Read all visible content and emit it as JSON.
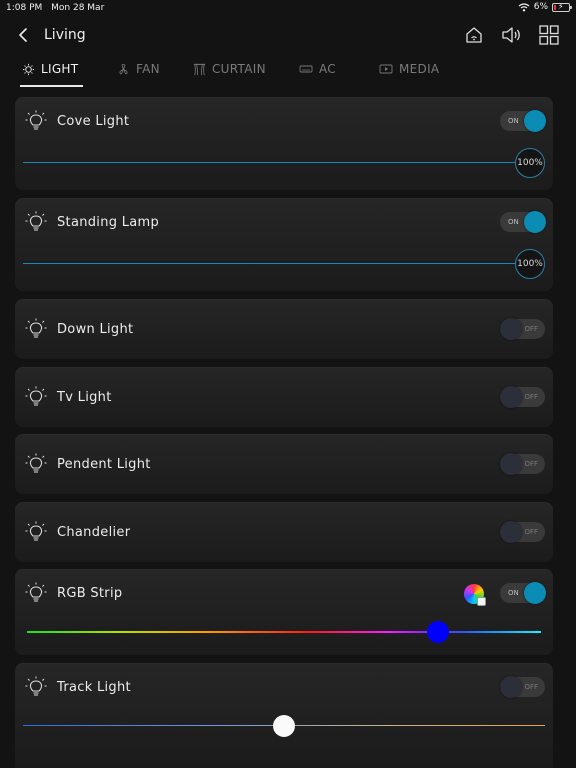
{
  "status_bar": {
    "time": "1:08 PM",
    "date": "Mon 28 Mar",
    "battery": "6%"
  },
  "header": {
    "title": "Living",
    "icons": [
      "back-chevron-icon",
      "home-icon",
      "speaker-icon",
      "grid-icon"
    ]
  },
  "tabs": [
    {
      "label": "LIGHT",
      "icon": "bulb-icon",
      "active": true
    },
    {
      "label": "FAN",
      "icon": "fan-icon",
      "active": false
    },
    {
      "label": "CURTAIN",
      "icon": "curtain-icon",
      "active": false
    },
    {
      "label": "AC",
      "icon": "ac-icon",
      "active": false
    },
    {
      "label": "MEDIA",
      "icon": "media-icon",
      "active": false
    }
  ],
  "devices": [
    {
      "name": "Cove Light",
      "toggle": "ON",
      "level_percent": 100,
      "level_label": "100%"
    },
    {
      "name": "Standing Lamp",
      "toggle": "ON",
      "level_percent": 100,
      "level_label": "100%"
    },
    {
      "name": "Down Light",
      "toggle": "OFF"
    },
    {
      "name": "Tv Light",
      "toggle": "OFF"
    },
    {
      "name": "Pendent Light",
      "toggle": "OFF"
    },
    {
      "name": "Chandelier",
      "toggle": "OFF"
    },
    {
      "name": "RGB Strip",
      "toggle": "ON",
      "hue_position": 0.8,
      "selected_color": "#0000ff"
    },
    {
      "name": "Track Light",
      "toggle": "OFF",
      "color_temp_position": 0.5
    }
  ],
  "colors": {
    "accent": "#0a8cb5",
    "card": "#222222",
    "background": "#131313"
  }
}
